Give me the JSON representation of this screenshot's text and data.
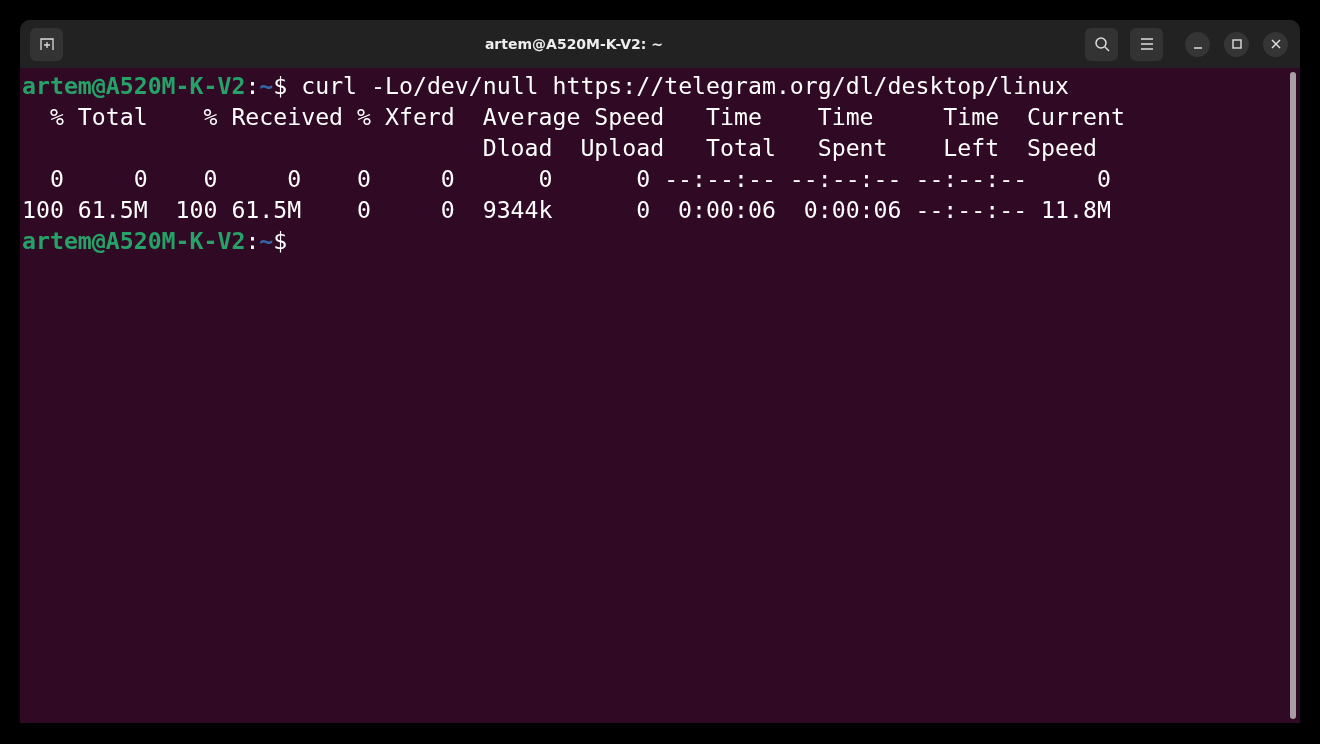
{
  "window": {
    "title": "artem@A520M-K-V2: ~"
  },
  "terminal": {
    "lines": [
      {
        "kind": "prompt",
        "user_host": "artem@A520M-K-V2",
        "separator": ":",
        "path": "~",
        "symbol": "$",
        "command": " curl -Lo/dev/null https://telegram.org/dl/desktop/linux"
      },
      {
        "kind": "output",
        "text": "  % Total    % Received % Xferd  Average Speed   Time    Time     Time  Current"
      },
      {
        "kind": "output",
        "text": "                                 Dload  Upload   Total   Spent    Left  Speed"
      },
      {
        "kind": "output",
        "text": "  0     0    0     0    0     0      0      0 --:--:-- --:--:-- --:--:--     0"
      },
      {
        "kind": "output",
        "text": "100 61.5M  100 61.5M    0     0  9344k      0  0:00:06  0:00:06 --:--:-- 11.8M"
      },
      {
        "kind": "prompt",
        "user_host": "artem@A520M-K-V2",
        "separator": ":",
        "path": "~",
        "symbol": "$"
      }
    ]
  }
}
